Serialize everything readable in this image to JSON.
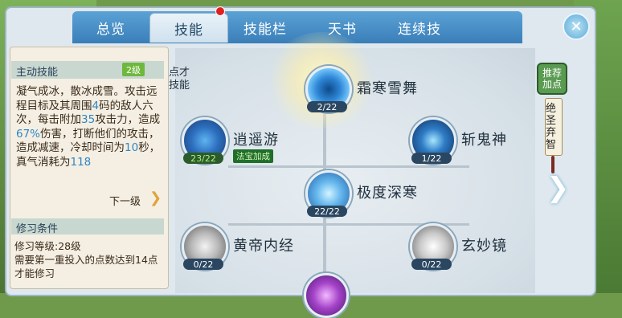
{
  "tabs": [
    {
      "label": "总览"
    },
    {
      "label": "技能"
    },
    {
      "label": "技能栏"
    },
    {
      "label": "天书"
    },
    {
      "label": "连续技"
    }
  ],
  "left": {
    "header": "主动技能",
    "level": "2级",
    "desc_parts": [
      "凝气成冰，散冰成雪。攻击远程目标及其周围",
      "4",
      "码的敌人六次，每击附加",
      "35",
      "攻击力，造成",
      "67%",
      "伤害，打断他们的攻击，造成减速，冷却时间为",
      "10",
      "秒，真气消耗为",
      "118"
    ],
    "next_label": "下一级",
    "req_header": "修习条件",
    "req_lines": [
      "修习等级:28级",
      "需要第一重投入的点数达到14点才能修习"
    ]
  },
  "overlay_text": [
    "点才",
    "技能"
  ],
  "nodes": [
    {
      "name": "霜寒雪舞",
      "count": "2/22",
      "badge": ""
    },
    {
      "name": "逍遥游",
      "count": "23/22",
      "badge": "法宝加成"
    },
    {
      "name": "斩鬼神",
      "count": "1/22",
      "badge": ""
    },
    {
      "name": "极度深寒",
      "count": "22/22",
      "badge": ""
    },
    {
      "name": "黄帝内经",
      "count": "0/22",
      "badge": ""
    },
    {
      "name": "玄妙镜",
      "count": "0/22",
      "badge": ""
    }
  ],
  "side": {
    "recommend": "推荐加点",
    "scroll": "绝圣弃智"
  },
  "colors": {
    "accent": "#3a7eb8",
    "highlight_num": "#2f86c6",
    "level_green": "#6fb83e"
  }
}
